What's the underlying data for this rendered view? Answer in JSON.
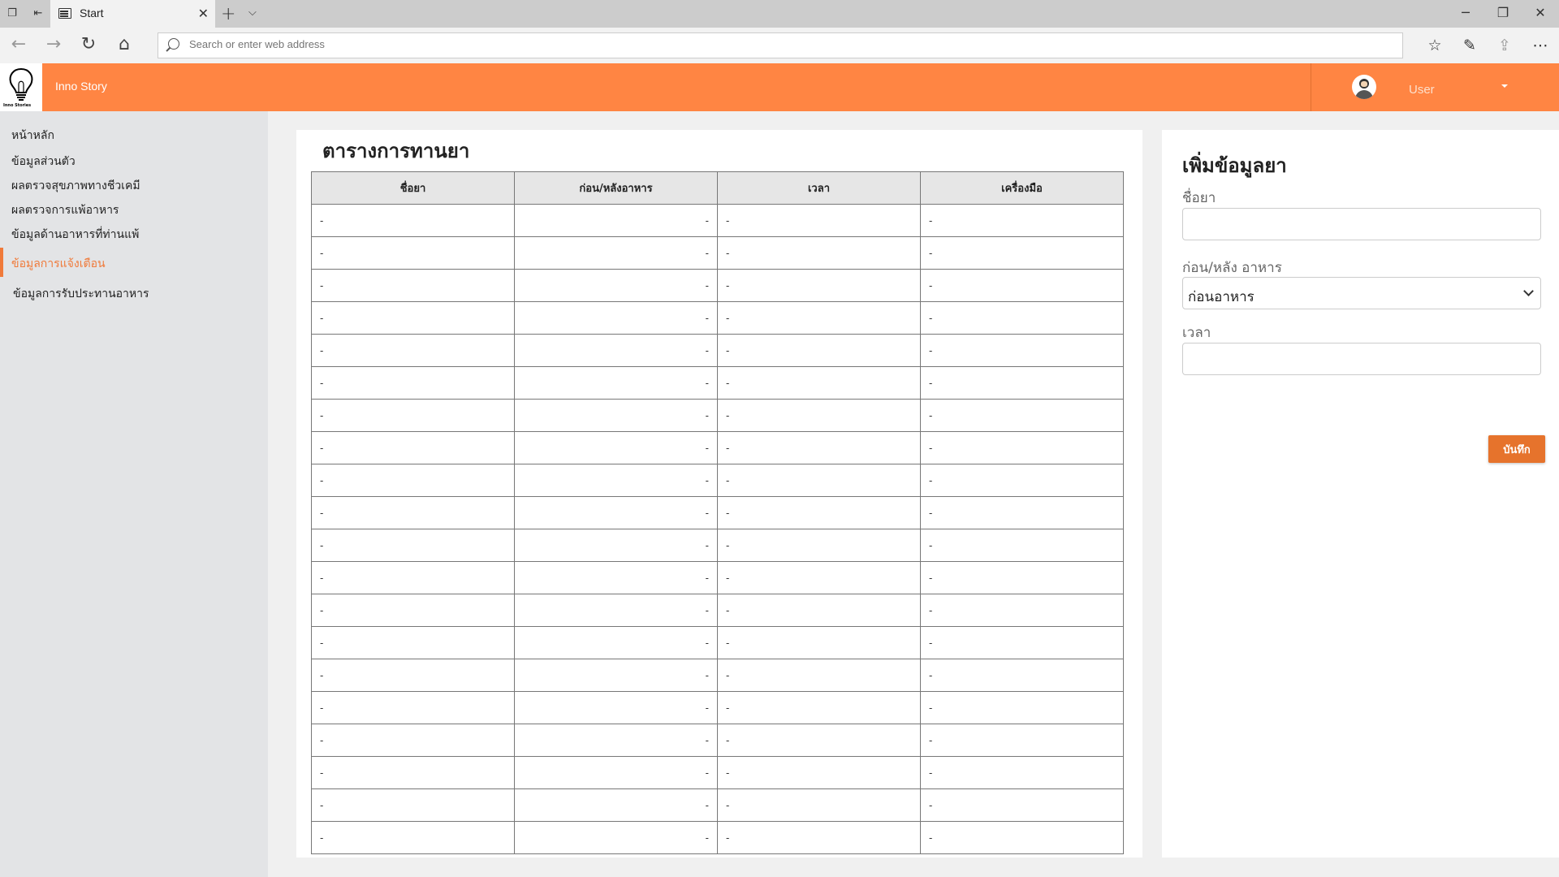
{
  "browser": {
    "tab_title": "Start",
    "address_placeholder": "Search or enter web address"
  },
  "app": {
    "title": "Inno Story",
    "logo_text": "Inno Stories",
    "user_name": "User"
  },
  "sidebar": {
    "items": [
      {
        "label": "หน้าหลัก"
      },
      {
        "label": "ข้อมูลส่วนตัว"
      },
      {
        "label": "ผลตรวจสุขภาพทางชีวเคมี"
      },
      {
        "label": "ผลตรวจการแพ้อาหาร"
      },
      {
        "label": "ข้อมูลด้านอาหารที่ท่านแพ้"
      },
      {
        "label": "ข้อมูลการแจ้งเตือน"
      },
      {
        "label": "ข้อมูลการรับประทานอาหาร"
      }
    ],
    "active_index": 5
  },
  "main": {
    "title": "ตารางการทานยา",
    "columns": [
      "ชื่อยา",
      "ก่อน/หลังอาหาร",
      "เวลา",
      "เครื่องมือ"
    ],
    "rows": [
      [
        "-",
        "-",
        "-",
        "-"
      ],
      [
        "-",
        "-",
        "-",
        "-"
      ],
      [
        "-",
        "-",
        "-",
        "-"
      ],
      [
        "-",
        "-",
        "-",
        "-"
      ],
      [
        "-",
        "-",
        "-",
        "-"
      ],
      [
        "-",
        "-",
        "-",
        "-"
      ],
      [
        "-",
        "-",
        "-",
        "-"
      ],
      [
        "-",
        "-",
        "-",
        "-"
      ],
      [
        "-",
        "-",
        "-",
        "-"
      ],
      [
        "-",
        "-",
        "-",
        "-"
      ],
      [
        "-",
        "-",
        "-",
        "-"
      ],
      [
        "-",
        "-",
        "-",
        "-"
      ],
      [
        "-",
        "-",
        "-",
        "-"
      ],
      [
        "-",
        "-",
        "-",
        "-"
      ],
      [
        "-",
        "-",
        "-",
        "-"
      ],
      [
        "-",
        "-",
        "-",
        "-"
      ],
      [
        "-",
        "-",
        "-",
        "-"
      ],
      [
        "-",
        "-",
        "-",
        "-"
      ],
      [
        "-",
        "-",
        "-",
        "-"
      ],
      [
        "-",
        "-",
        "-",
        "-"
      ]
    ]
  },
  "form": {
    "title": "เพิ่มข้อมูลยา",
    "name_label": "ชื่อยา",
    "name_value": "",
    "meal_label": "ก่อน/หลัง อาหาร",
    "meal_value": "ก่อนอาหาร",
    "time_label": "เวลา",
    "time_value": "",
    "save_label": "บันทึก"
  },
  "colors": {
    "accent": "#ff8543",
    "active_text": "#f07a3a",
    "button": "#e6732c"
  }
}
